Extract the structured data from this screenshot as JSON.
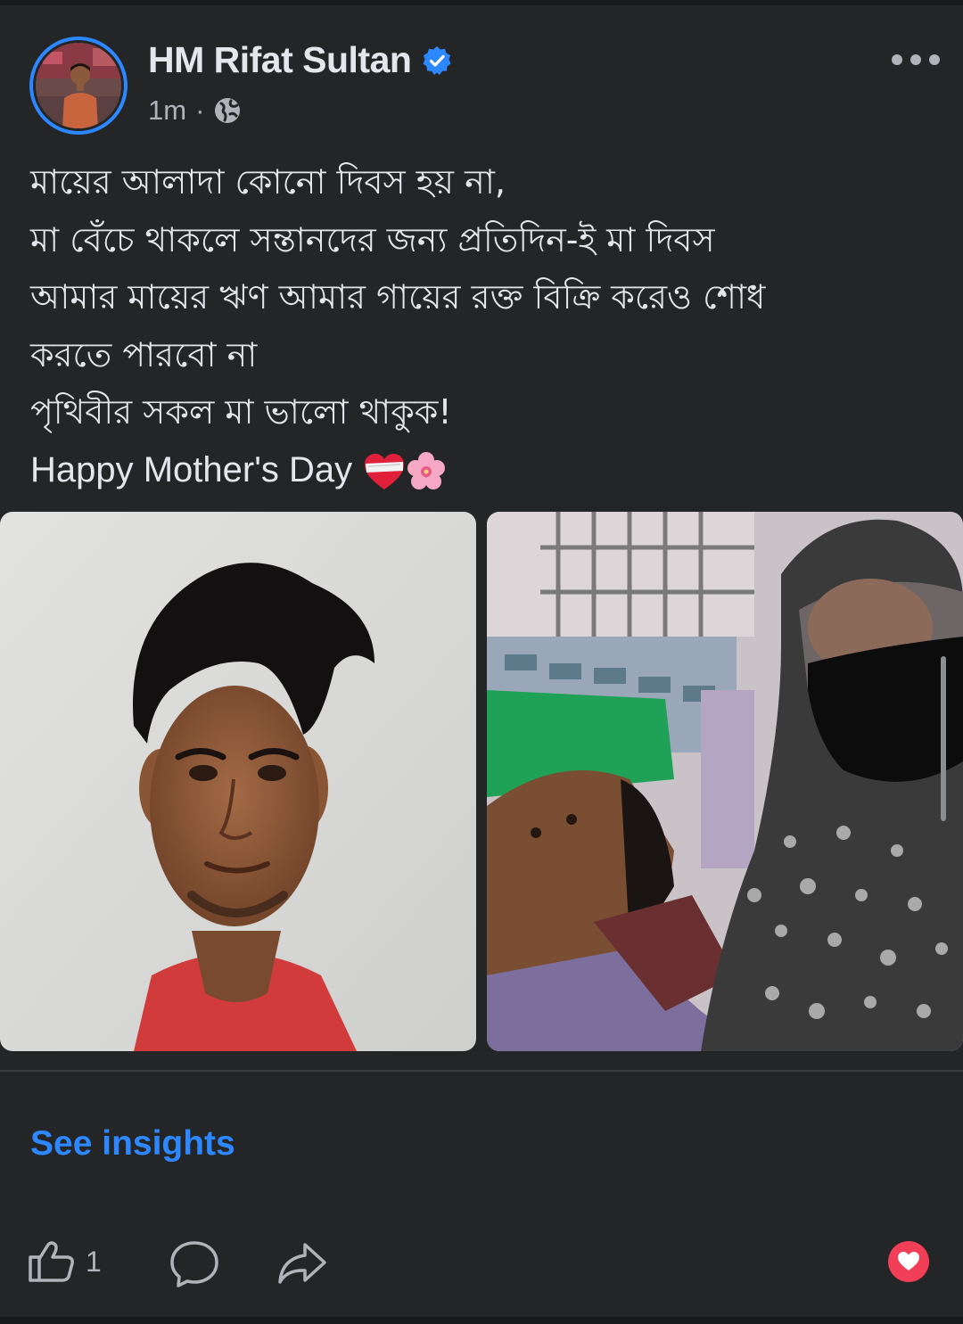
{
  "post": {
    "author_name": "HM Rifat Sultan",
    "timestamp": "1m",
    "separator": "·",
    "privacy_icon": "globe-icon",
    "verified_icon": "verified-badge-icon",
    "caption_lines": [
      "মায়ের আলাদা কোনো দিবস হয় না,",
      "মা বেঁচে থাকলে সন্তানদের জন্য প্রতিদিন-ই মা দিবস",
      "আমার মায়ের ঋণ আমার গায়ের রক্ত বিক্রি করেও শোধ",
      "করতে পারবো না",
      "পৃথিবীর সকল মা ভালো থাকুক!"
    ],
    "caption_english": "Happy Mother's Day"
  },
  "footer": {
    "insights_label": "See insights",
    "like_count": "1"
  },
  "colors": {
    "background": "#242526",
    "accent": "#2d88ff",
    "text_primary": "#e4e6eb",
    "text_secondary": "#b0b3b8",
    "reaction_love": "#f33e58"
  }
}
